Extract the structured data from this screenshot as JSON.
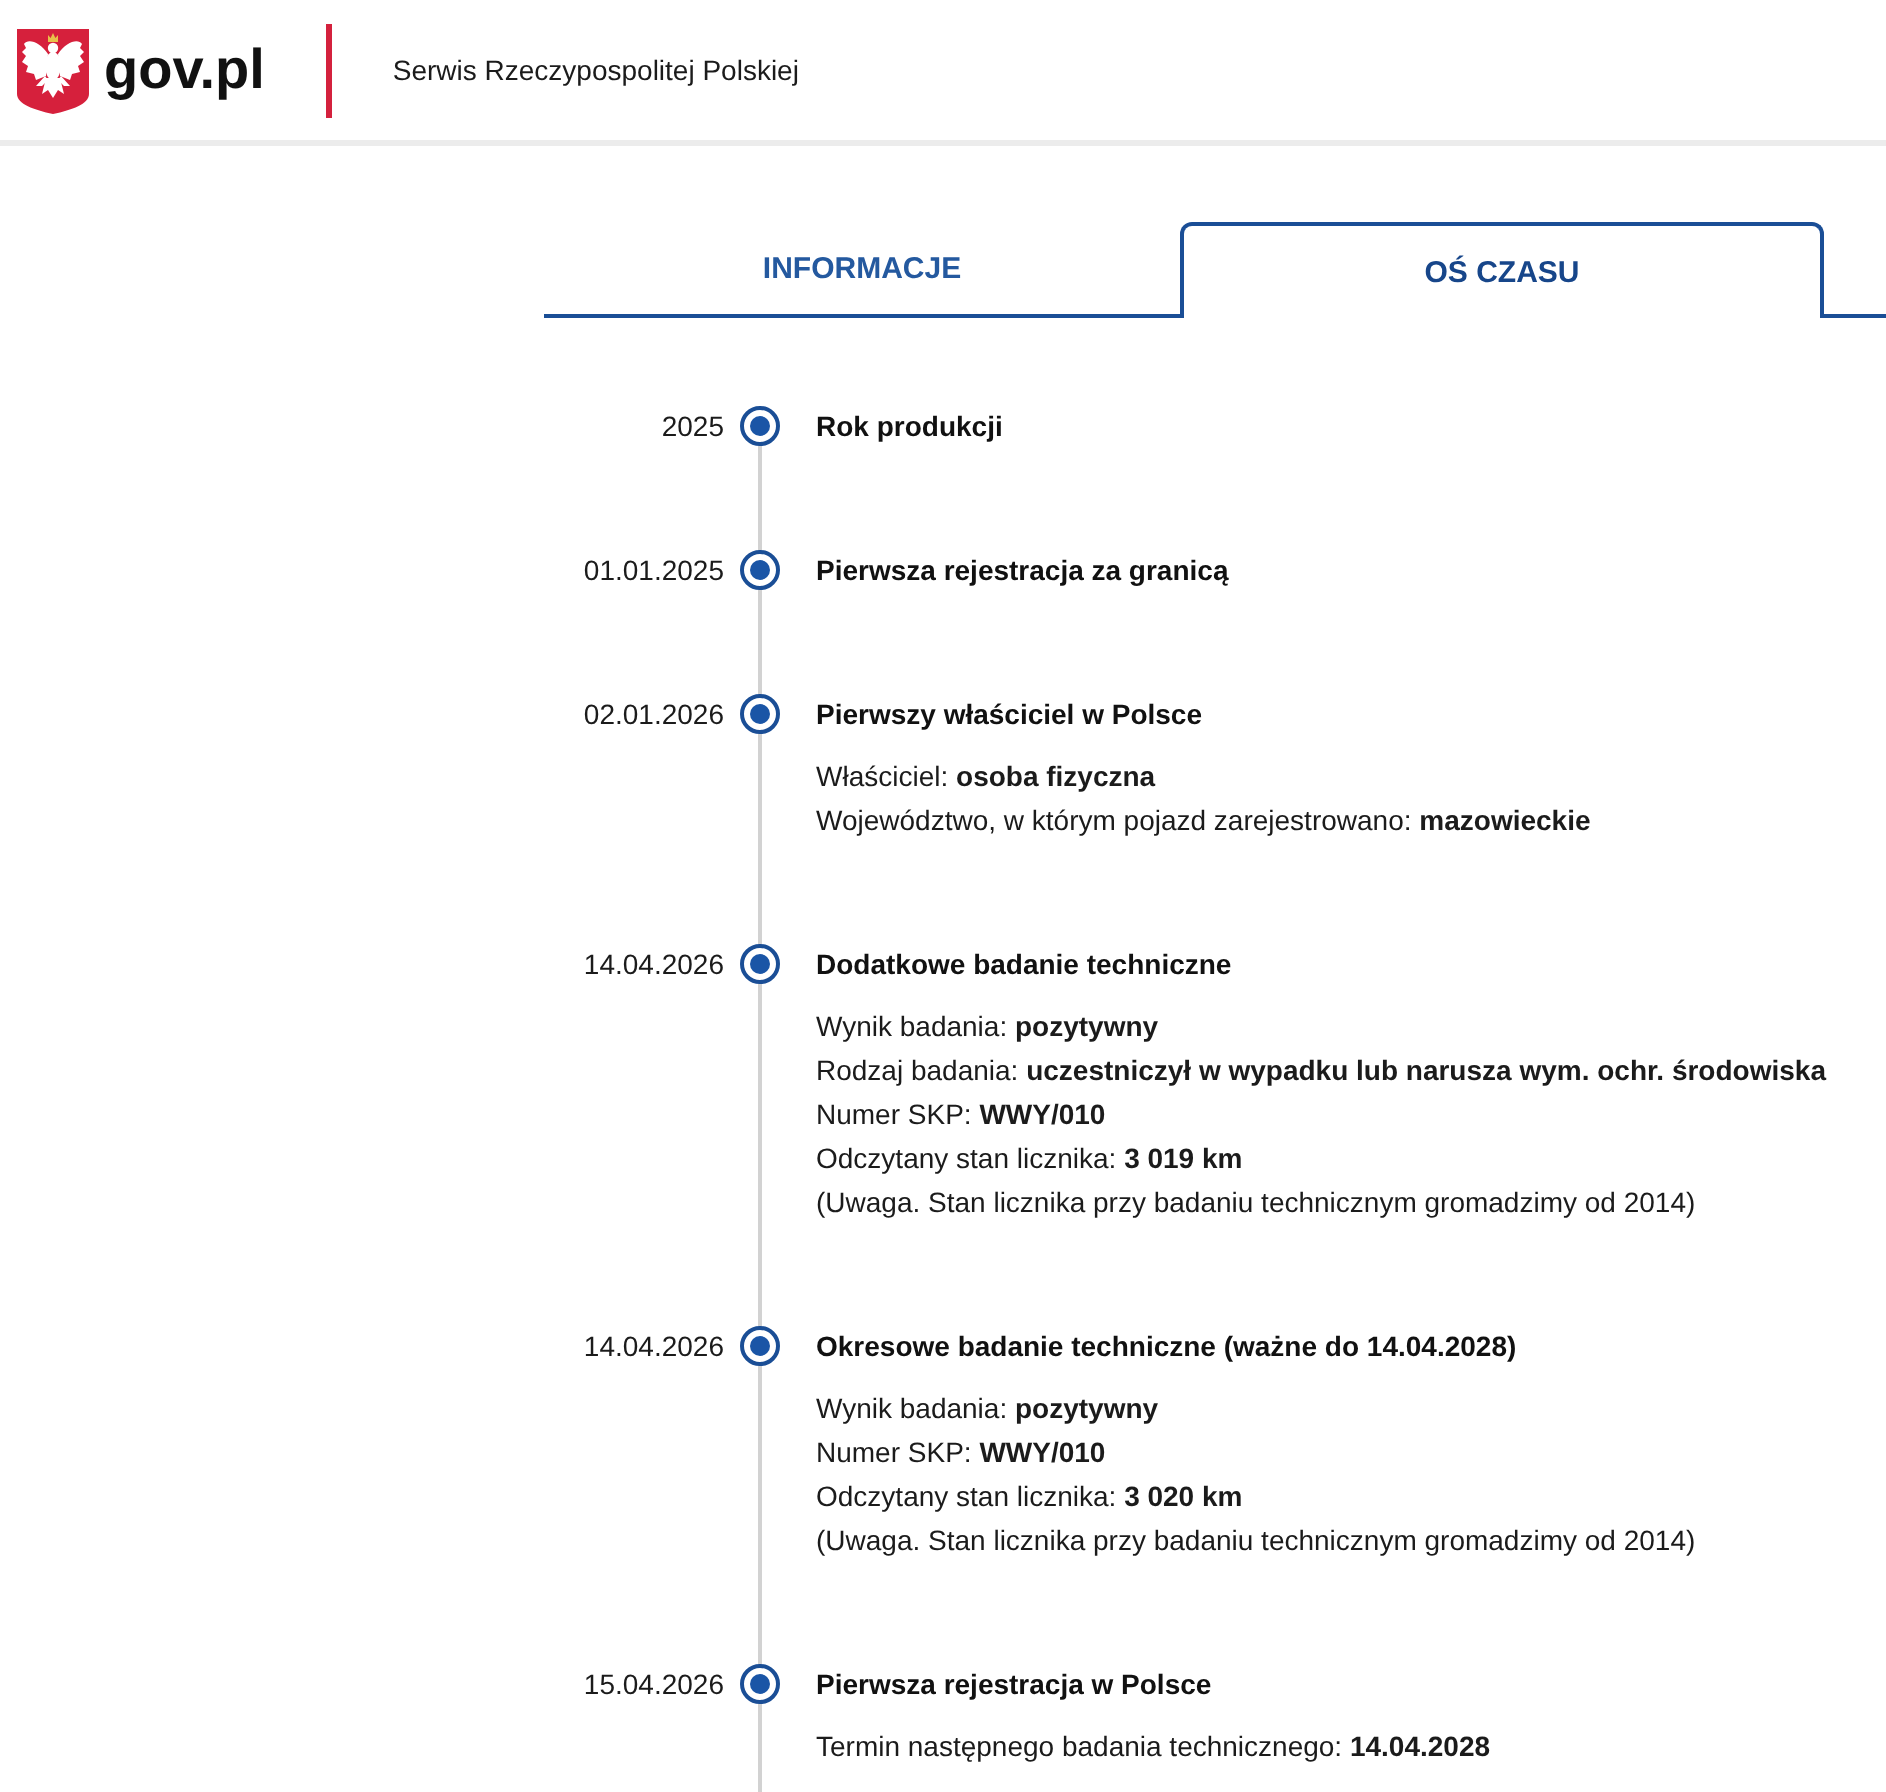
{
  "header": {
    "logo_text": "gov.pl",
    "site_title": "Serwis Rzeczypospolitej Polskiej"
  },
  "tabs": [
    {
      "label": "INFORMACJE",
      "selected": false
    },
    {
      "label": "OŚ CZASU",
      "selected": true
    }
  ],
  "timeline": [
    {
      "date": "2025",
      "title": "Rok produkcji"
    },
    {
      "date": "01.01.2025",
      "title": "Pierwsza rejestracja za granicą"
    },
    {
      "date": "02.01.2026",
      "title": "Pierwszy właściciel w Polsce",
      "details": [
        "Właściciel: **osoba fizyczna**",
        "Województwo, w którym pojazd zarejestrowano: **mazowieckie**"
      ]
    },
    {
      "date": "14.04.2026",
      "title": "Dodatkowe badanie techniczne",
      "details": [
        "Wynik badania: **pozytywny**",
        "Rodzaj badania: **uczestniczył w wypadku lub narusza wym. ochr. środowiska**",
        "Numer SKP: **WWY/010**",
        "Odczytany stan licznika: **3 019 km**",
        "(Uwaga. Stan licznika przy badaniu technicznym gromadzimy od 2014)"
      ]
    },
    {
      "date": "14.04.2026",
      "title": "Okresowe badanie techniczne (ważne do 14.04.2028)",
      "details": [
        "Wynik badania: **pozytywny**",
        "Numer SKP: **WWY/010**",
        "Odczytany stan licznika: **3 020 km**",
        "(Uwaga. Stan licznika przy badaniu technicznym gromadzimy od 2014)"
      ]
    },
    {
      "date": "15.04.2026",
      "title": "Pierwsza rejestracja w Polsce",
      "details": [
        "Termin następnego badania technicznego: **14.04.2028**"
      ]
    }
  ]
}
